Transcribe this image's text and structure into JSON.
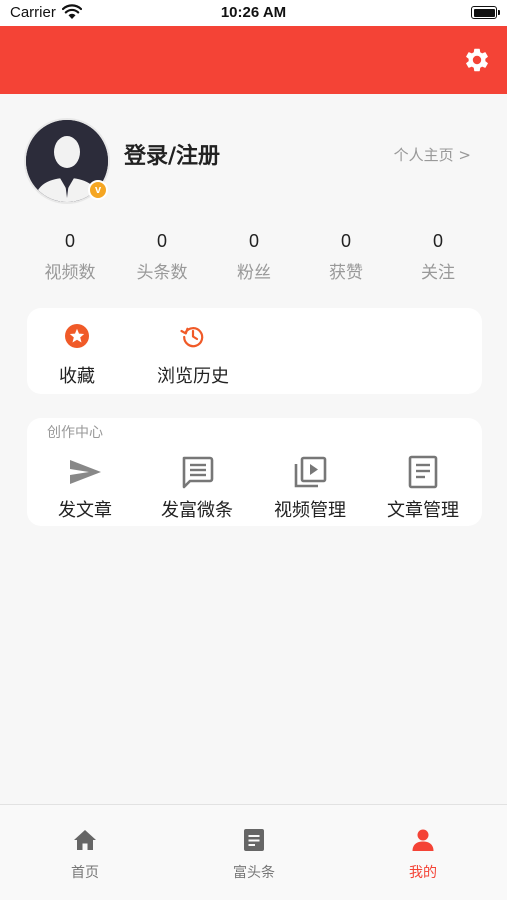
{
  "status_bar": {
    "carrier": "Carrier",
    "time": "10:26 AM"
  },
  "colors": {
    "accent": "#f44336",
    "badge": "#f5a623",
    "muted": "#999999"
  },
  "profile": {
    "login_label": "登录/注册",
    "homepage_link": "个人主页 >",
    "badge_text": "v"
  },
  "stats": [
    {
      "value": "0",
      "label": "视频数"
    },
    {
      "value": "0",
      "label": "头条数"
    },
    {
      "value": "0",
      "label": "粉丝"
    },
    {
      "value": "0",
      "label": "获赞"
    },
    {
      "value": "0",
      "label": "关注"
    }
  ],
  "quick_actions": [
    {
      "label": "收藏",
      "icon": "star-icon"
    },
    {
      "label": "浏览历史",
      "icon": "history-icon"
    }
  ],
  "creation_center": {
    "title": "创作中心",
    "items": [
      {
        "label": "发文章",
        "icon": "send-icon"
      },
      {
        "label": "发富微条",
        "icon": "message-icon"
      },
      {
        "label": "视频管理",
        "icon": "video-library-icon"
      },
      {
        "label": "文章管理",
        "icon": "article-icon"
      }
    ]
  },
  "tab_bar": {
    "items": [
      {
        "label": "首页",
        "icon": "home-icon"
      },
      {
        "label": "富头条",
        "icon": "news-icon"
      },
      {
        "label": "我的",
        "icon": "person-icon",
        "active": true
      }
    ]
  }
}
